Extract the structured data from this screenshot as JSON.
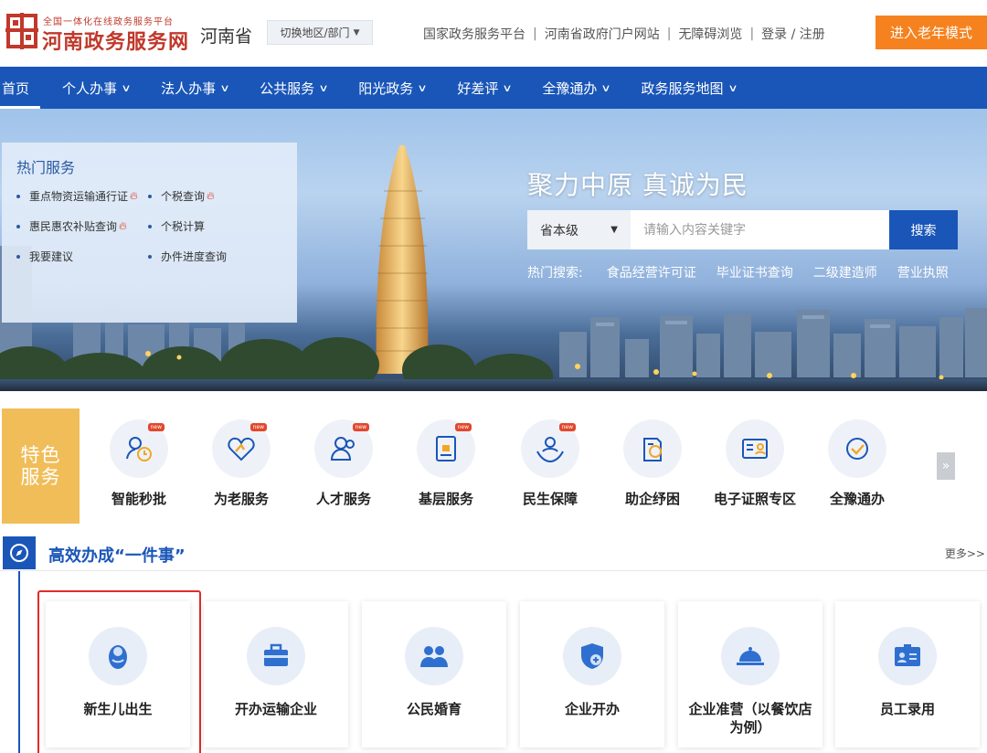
{
  "header": {
    "logo_subtitle": "全国一体化在线政务服务平台",
    "logo_title": "河南政务服务网",
    "province": "河南省",
    "region_switch": "切换地区/部门",
    "links": [
      "国家政务服务平台",
      "河南省政府门户网站",
      "无障碍浏览",
      "登录 / 注册"
    ],
    "elder_mode": "进入老年模式"
  },
  "nav": {
    "items": [
      {
        "label": "首页",
        "dropdown": false
      },
      {
        "label": "个人办事",
        "dropdown": true
      },
      {
        "label": "法人办事",
        "dropdown": true
      },
      {
        "label": "公共服务",
        "dropdown": true
      },
      {
        "label": "阳光政务",
        "dropdown": true
      },
      {
        "label": "好差评",
        "dropdown": true
      },
      {
        "label": "全豫通办",
        "dropdown": true
      },
      {
        "label": "政务服务地图",
        "dropdown": true
      }
    ]
  },
  "banner": {
    "hot_services": {
      "title": "热门服务",
      "items": [
        {
          "label": "重点物资运输通行证",
          "hot": true
        },
        {
          "label": "个税查询",
          "hot": true
        },
        {
          "label": "惠民惠农补贴查询",
          "hot": true
        },
        {
          "label": "个税计算",
          "hot": false
        },
        {
          "label": "我要建议",
          "hot": false
        },
        {
          "label": "办件进度查询",
          "hot": false
        }
      ]
    },
    "slogan": "聚力中原   真诚为民",
    "search": {
      "scope": "省本级",
      "placeholder": "请输入内容关键字",
      "button": "搜索",
      "hot_label": "热门搜索:",
      "hot_terms": [
        "食品经营许可证",
        "毕业证书查询",
        "二级建造师",
        "营业执照"
      ]
    }
  },
  "features": {
    "badge_line1": "特色",
    "badge_line2": "服务",
    "items": [
      {
        "label": "智能秒批",
        "icon": "smart-approval-icon",
        "new": true
      },
      {
        "label": "为老服务",
        "icon": "elderly-service-icon",
        "new": true
      },
      {
        "label": "人才服务",
        "icon": "talent-service-icon",
        "new": true
      },
      {
        "label": "基层服务",
        "icon": "grassroots-service-icon",
        "new": true
      },
      {
        "label": "民生保障",
        "icon": "livelihood-icon",
        "new": true
      },
      {
        "label": "助企纾困",
        "icon": "enterprise-relief-icon",
        "new": false
      },
      {
        "label": "电子证照专区",
        "icon": "e-license-icon",
        "new": false
      },
      {
        "label": "全豫通办",
        "icon": "province-wide-icon",
        "new": false
      }
    ],
    "new_tag": "new",
    "next": "»"
  },
  "one_thing": {
    "title": "高效办成“一件事”",
    "more": "更多>>",
    "cards": [
      {
        "label": "新生儿出生",
        "icon": "baby-icon"
      },
      {
        "label": "开办运输企业",
        "icon": "briefcase-icon"
      },
      {
        "label": "公民婚育",
        "icon": "couple-icon"
      },
      {
        "label": "企业开办",
        "icon": "enterprise-shield-icon"
      },
      {
        "label": "企业准营（以餐饮店为例）",
        "icon": "cloche-icon"
      },
      {
        "label": "员工录用",
        "icon": "id-card-icon"
      }
    ]
  },
  "colors": {
    "primary": "#1a56b8",
    "accent": "#f5821f",
    "feature_badge": "#f1bd58",
    "highlight": "#e02b2b",
    "logo_red": "#c0392b"
  }
}
